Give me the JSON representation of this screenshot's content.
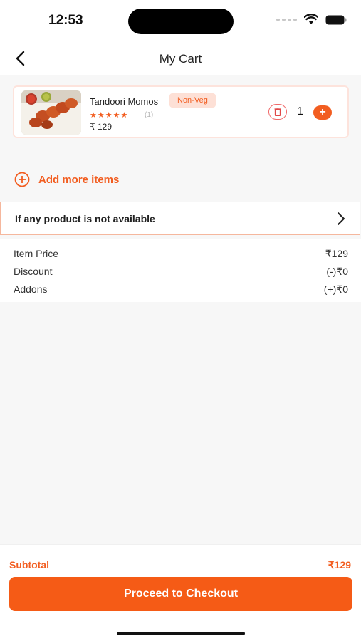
{
  "status_bar": {
    "time": "12:53"
  },
  "header": {
    "title": "My Cart"
  },
  "cart_item": {
    "name": "Tandoori Momos",
    "badge": "Non-Veg",
    "stars": "★★★★★",
    "rating": 5,
    "review_count": "(1)",
    "price": "₹ 129",
    "quantity": "1",
    "add_symbol": "+"
  },
  "add_more": {
    "label": "Add more items"
  },
  "availability": {
    "label": "If any product is not available"
  },
  "summary": {
    "rows": [
      {
        "label": "Item Price",
        "value": "₹129"
      },
      {
        "label": "Discount",
        "value": "(-)₹0"
      },
      {
        "label": "Addons",
        "value": "(+)₹0"
      }
    ]
  },
  "footer": {
    "subtotal_label": "Subtotal",
    "subtotal_value": "₹129",
    "checkout_label": "Proceed to Checkout"
  },
  "colors": {
    "accent": "#f25d20",
    "button": "#f55b16",
    "badge_bg": "#fde0d6"
  },
  "icons": [
    "back-chevron-icon",
    "wifi-icon",
    "battery-icon",
    "trash-icon",
    "plus-circle-icon",
    "chevron-right-icon"
  ]
}
